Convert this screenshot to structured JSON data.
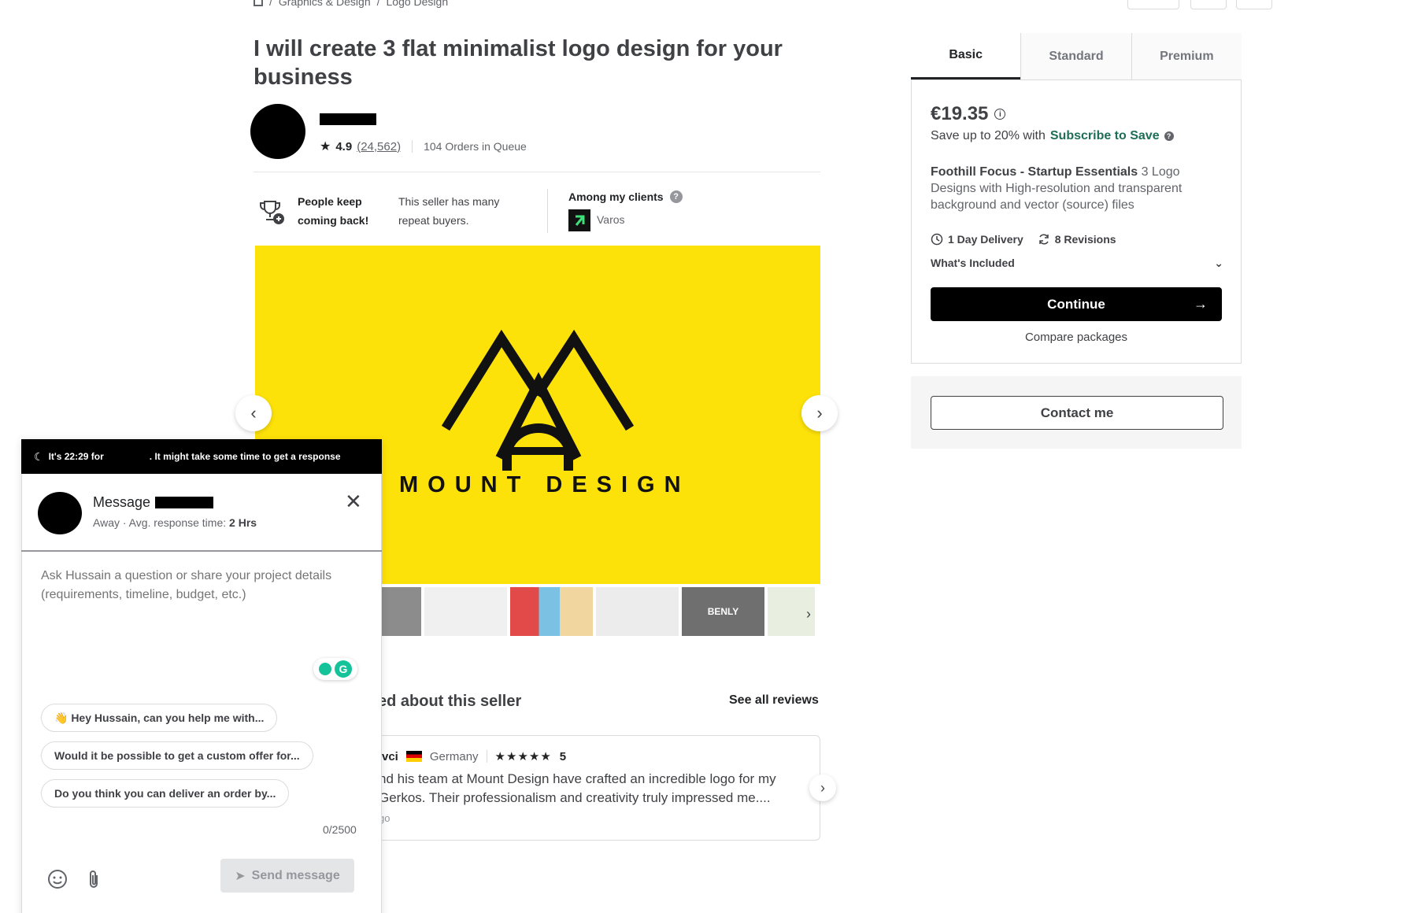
{
  "breadcrumb": {
    "items": [
      "Graphics & Design",
      "Logo Design"
    ],
    "separator": "/"
  },
  "gig": {
    "title": "I will create 3 flat minimalist logo design for your business",
    "rating": "4.9",
    "rating_count": "(24,562)",
    "orders_in_queue": "104 Orders in Queue"
  },
  "highlights": {
    "repeat_title": "People keep coming back!",
    "repeat_text": "This seller has many repeat buyers.",
    "clients_title": "Among my clients",
    "client_name": "Varos"
  },
  "gallery": {
    "image_text": "MOUNT DESIGN",
    "thumb_label": "BENLY"
  },
  "reviews": {
    "title_visible": "ed about this seller",
    "see_all": "See all reviews",
    "reviewer_partial": "vci",
    "country": "Germany",
    "stars": "★★★★★",
    "score": "5",
    "text": "nd his team at Mount Design have crafted an incredible logo for my Gerkos. Their professionalism and creativity truly impressed me....",
    "ago_partial": "go"
  },
  "packages": {
    "tabs": [
      "Basic",
      "Standard",
      "Premium"
    ],
    "active_tab": "Basic",
    "price": "€19.35",
    "save_prefix": "Save up to 20% with",
    "save_link": "Subscribe to Save",
    "desc_bold": "Foothill Focus - Startup Essentials",
    "desc_rest": " 3 Logo Designs with High-resolution and transparent background and vector (source) files",
    "delivery": "1 Day Delivery",
    "revisions": "8 Revisions",
    "whats_included": "What's Included",
    "continue": "Continue",
    "compare": "Compare packages",
    "contact": "Contact me"
  },
  "chat": {
    "banner_prefix": "It's 22:29 for",
    "banner_suffix": ". It might take some time to get a response",
    "title": "Message",
    "status": "Away",
    "response_label": "Avg. response time:",
    "response_value": "2 Hrs",
    "placeholder": "Ask Hussain a question or share your project details (requirements, timeline, budget, etc.)",
    "suggestions": [
      "👋 Hey Hussain, can you help me with...",
      "Would it be possible to get a custom offer for...",
      "Do you think you can deliver an order by..."
    ],
    "char_count": "0/2500",
    "send": "Send message"
  },
  "colors": {
    "gallery_bg": "#fde209",
    "accent_green": "#1d6e55",
    "black": "#000000"
  }
}
